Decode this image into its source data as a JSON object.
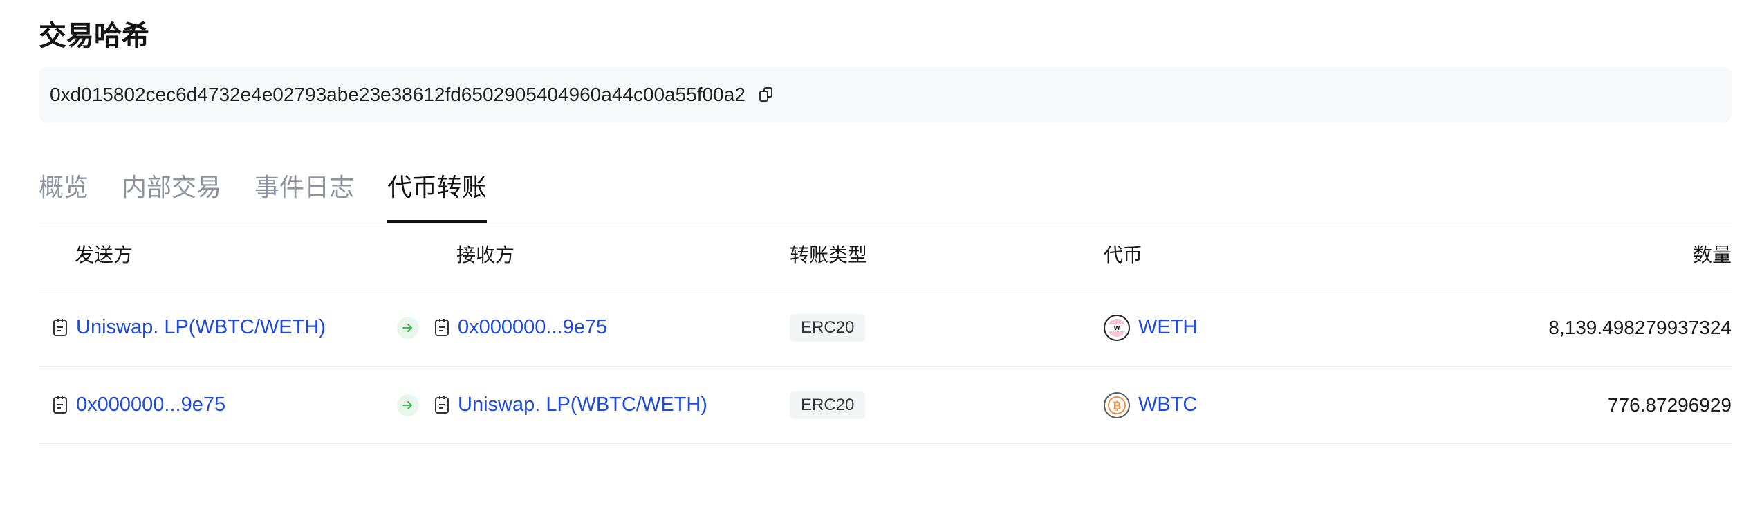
{
  "section": {
    "title": "交易哈希"
  },
  "hash": {
    "value": "0xd015802cec6d4732e4e02793abe23e38612fd6502905404960a44c00a55f00a2"
  },
  "tabs": [
    {
      "label": "概览",
      "active": false
    },
    {
      "label": "内部交易",
      "active": false
    },
    {
      "label": "事件日志",
      "active": false
    },
    {
      "label": "代币转账",
      "active": true
    }
  ],
  "table": {
    "headers": {
      "from": "发送方",
      "to": "接收方",
      "type": "转账类型",
      "token": "代币",
      "amount": "数量"
    },
    "rows": [
      {
        "from": "Uniswap. LP(WBTC/WETH)",
        "to": "0x000000...9e75",
        "type": "ERC20",
        "token": "WETH",
        "token_icon": "weth-token-icon",
        "amount": "8,139.498279937324"
      },
      {
        "from": "0x000000...9e75",
        "to": "Uniswap. LP(WBTC/WETH)",
        "type": "ERC20",
        "token": "WBTC",
        "token_icon": "wbtc-token-icon",
        "amount": "776.87296929"
      }
    ]
  },
  "colors": {
    "link": "#1f4bd8",
    "arrow_bg": "#e8f6ec",
    "arrow": "#3bb55c",
    "tab_inactive": "#8e949e",
    "tab_active": "#111111",
    "hash_bg": "#f7f8fa"
  }
}
